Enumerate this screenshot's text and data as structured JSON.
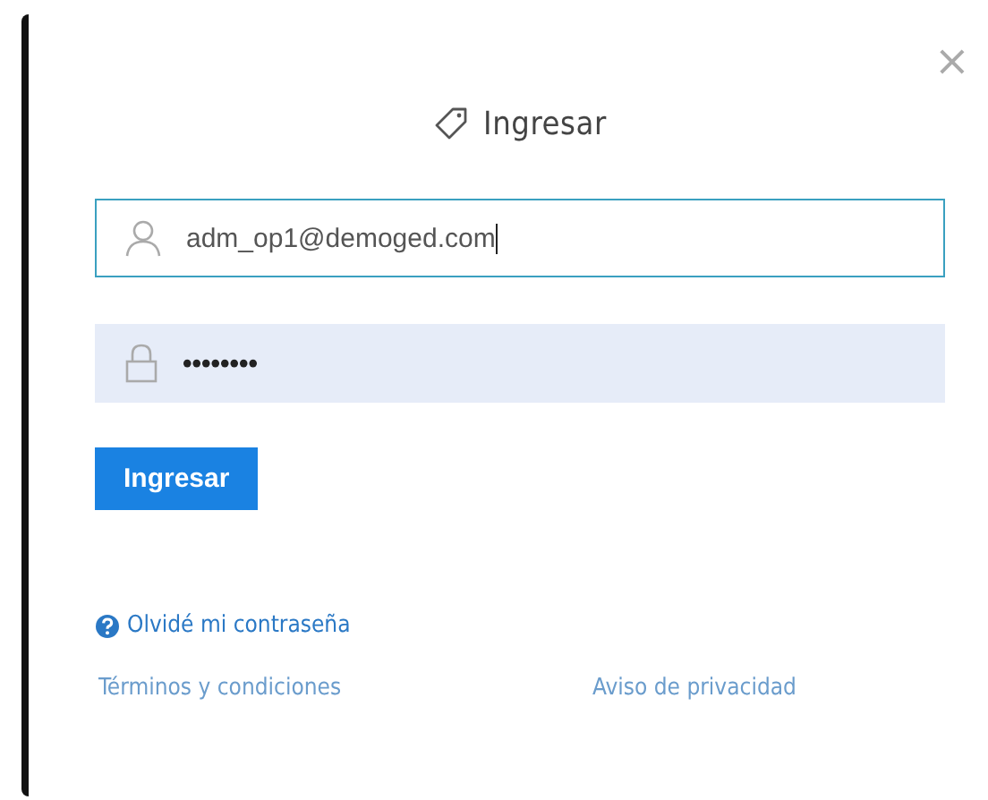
{
  "dialog": {
    "title": "Ingresar",
    "close": "×"
  },
  "fields": [
    {
      "kind": "user",
      "value": "adm_op1@demoged.com",
      "focused": true
    },
    {
      "kind": "password",
      "value": "••••••••",
      "focused": false
    }
  ],
  "submit": "Ingresar",
  "forgot_link": "Olvidé mi contraseña",
  "footer_links": [
    "Términos y condiciones",
    "Aviso de privacidad"
  ]
}
